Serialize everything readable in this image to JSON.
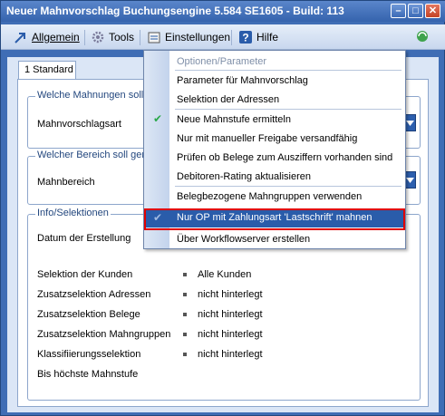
{
  "window": {
    "title": "Neuer Mahnvorschlag    Buchungsengine 5.584 SE1605 - Build: 113"
  },
  "toolbar": {
    "allgemein": "Allgemein",
    "tools": "Tools",
    "einstellungen": "Einstellungen",
    "hilfe": "Hilfe"
  },
  "tab": {
    "label": "1 Standard"
  },
  "groups": {
    "mahnungen": {
      "title": "Welche Mahnungen sollen",
      "field_label": "Mahnvorschlagsart"
    },
    "bereich": {
      "title": "Welcher Bereich soll gema",
      "field_label": "Mahnbereich"
    },
    "info": {
      "title": "Info/Selektionen",
      "datum_label": "Datum der Erstellung"
    }
  },
  "selections": [
    {
      "label": "Selektion der Kunden",
      "value": "Alle Kunden"
    },
    {
      "label": "Zusatzselektion Adressen",
      "value": "nicht hinterlegt"
    },
    {
      "label": "Zusatzselektion Belege",
      "value": "nicht hinterlegt"
    },
    {
      "label": "Zusatzselektion Mahngruppen",
      "value": "nicht hinterlegt"
    },
    {
      "label": "Klassifiierungsselektion",
      "value": "nicht hinterlegt"
    },
    {
      "label": "Bis höchste Mahnstufe",
      "value": ""
    }
  ],
  "menu": {
    "header": "Optionen/Parameter",
    "items": [
      "Parameter für Mahnvorschlag",
      "Selektion der Adressen",
      "Neue Mahnstufe ermitteln",
      "Nur mit manueller Freigabe versandfähig",
      "Prüfen ob Belege zum Ausziffern vorhanden sind",
      "Debitoren-Rating aktualisieren",
      "Belegbezogene Mahngruppen verwenden",
      "Nur OP mit Zahlungsart 'Lastschrift' mahnen",
      "Über Workflowserver erstellen"
    ]
  },
  "colors": {
    "accent": "#2a5caa",
    "highlight_border": "#e00000"
  }
}
